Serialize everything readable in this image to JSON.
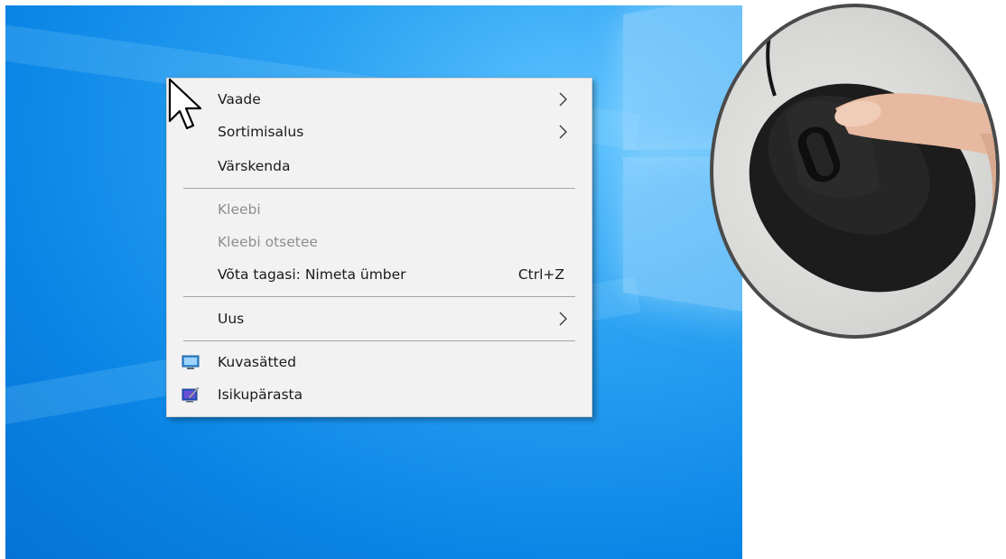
{
  "context_menu": {
    "items": [
      {
        "label": "Vaade",
        "submenu": true,
        "enabled": true
      },
      {
        "label": "Sortimisalus",
        "submenu": true,
        "enabled": true
      },
      {
        "label": "Värskenda",
        "enabled": true
      },
      {
        "label": "Kleebi",
        "enabled": false
      },
      {
        "label": "Kleebi otsetee",
        "enabled": false
      },
      {
        "label": "Võta tagasi: Nimeta ümber",
        "accelerator": "Ctrl+Z",
        "enabled": true
      },
      {
        "label": "Uus",
        "submenu": true,
        "enabled": true
      },
      {
        "label": "Kuvasätted",
        "icon": "display-settings-icon",
        "enabled": true
      },
      {
        "label": "Isikupärasta",
        "icon": "personalize-icon",
        "enabled": true
      }
    ]
  },
  "colors": {
    "desktop_blue": "#0a86e6",
    "menu_background": "#f2f2f2",
    "disabled_text": "#8d8d8d"
  }
}
